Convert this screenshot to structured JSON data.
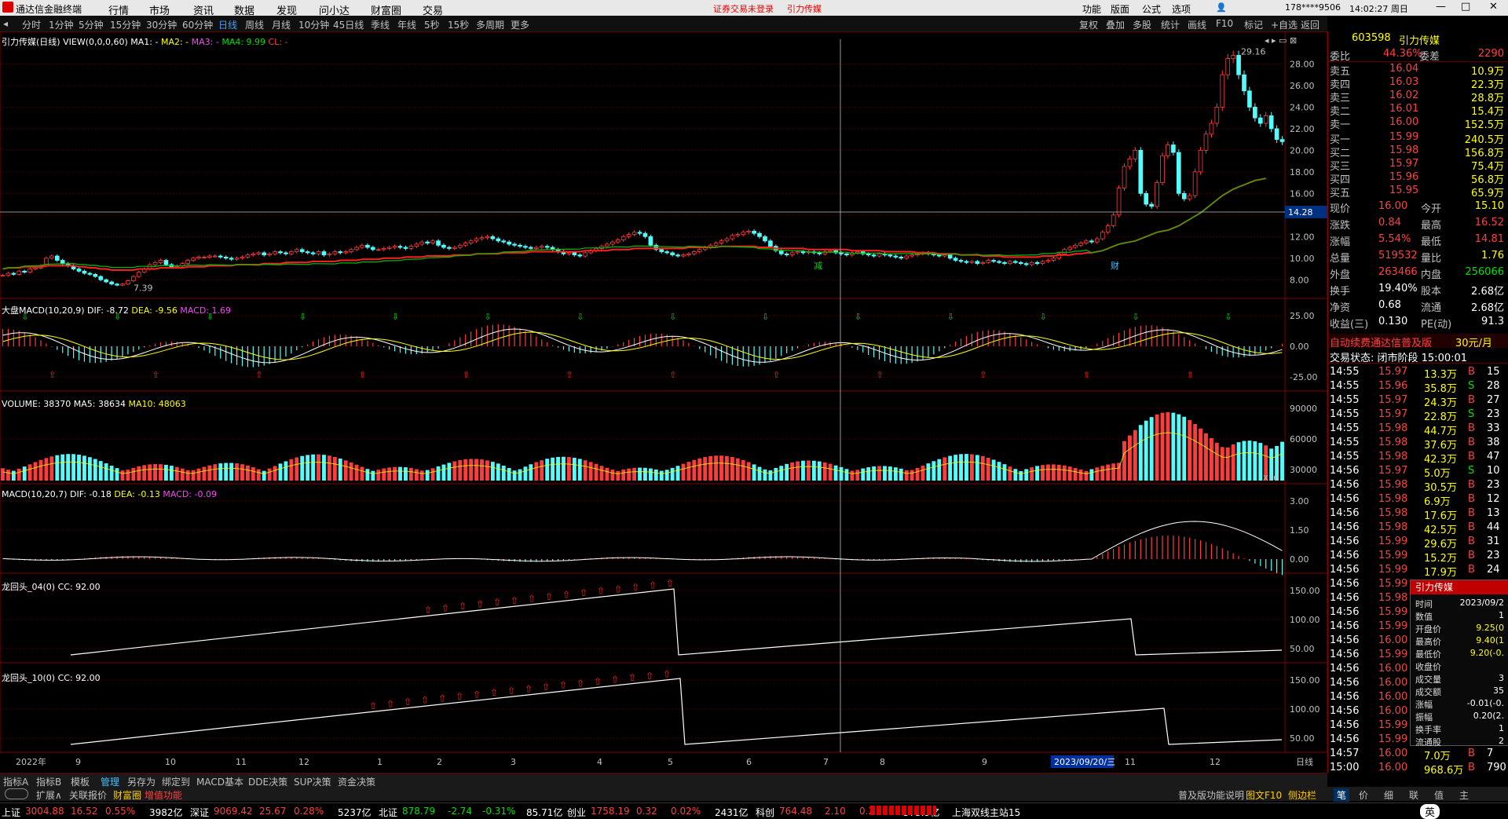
{
  "app": {
    "title": "通达信金融终端",
    "menu": [
      "行情",
      "市场",
      "资讯",
      "数据",
      "发现",
      "问小达",
      "财富圈",
      "交易"
    ],
    "notice": "证券交易未登录",
    "stock_name": "引力传媒",
    "right_menu": [
      "功能",
      "版面",
      "公式",
      "选项"
    ],
    "account": "178****9506",
    "clock": "14:02:27 周日"
  },
  "periods": [
    "分时",
    "1分钟",
    "5分钟",
    "15分钟",
    "30分钟",
    "60分钟",
    "日线",
    "周线",
    "月线",
    "10分钟",
    "45日线",
    "季线",
    "年线",
    "5秒",
    "15秒",
    "多周期",
    "更多"
  ],
  "toolbar_right": [
    "复权",
    "叠加",
    "多股",
    "统计",
    "画线",
    "F10",
    "标记",
    "+自选",
    "返回"
  ],
  "chart_data": [
    {
      "type": "line",
      "name": "main",
      "header": {
        "title": "引力传媒(日线)",
        "view": "VIEW(0,0,0,60)",
        "ma1": "MA1: -",
        "ma2": "MA2: -",
        "ma3": "MA3: -",
        "ma4": "MA4: 9.99",
        "ma5": "CL: -"
      },
      "ylim": [
        7,
        30
      ],
      "ticks": [
        8,
        10,
        12,
        14,
        16,
        18,
        20,
        22,
        24,
        26,
        28
      ],
      "tick_labels": [
        "8.00",
        "10.00",
        "12.00",
        "14.00",
        "16.00",
        "18.00",
        "20.00",
        "22.00",
        "24.00",
        "26.00",
        "28.00"
      ],
      "annotations": {
        "high": "29.16",
        "low": "7.39",
        "crosshair_price": "14.28",
        "marker1": "减",
        "marker2": "财"
      },
      "close": [
        8.4,
        8.6,
        8.5,
        8.8,
        8.7,
        9.0,
        9.1,
        9.3,
        10.0,
        10.2,
        9.8,
        9.5,
        9.3,
        9.0,
        8.8,
        8.6,
        8.5,
        8.3,
        8.0,
        7.8,
        7.6,
        7.5,
        7.6,
        7.9,
        8.3,
        8.7,
        9.0,
        9.4,
        9.6,
        9.8,
        9.4,
        9.2,
        9.3,
        9.5,
        9.8,
        10.0,
        10.1,
        10.1,
        10.2,
        10.2,
        10.1,
        10.0,
        9.9,
        10.0,
        10.1,
        10.3,
        10.4,
        10.5,
        10.3,
        10.4,
        10.6,
        10.5,
        10.4,
        10.6,
        10.8,
        10.6,
        10.5,
        10.4,
        10.6,
        10.3,
        10.4,
        10.6,
        10.5,
        10.6,
        10.8,
        11.0,
        11.2,
        11.0,
        10.8,
        10.8,
        10.9,
        11.0,
        11.1,
        11.0,
        10.9,
        11.1,
        11.3,
        11.5,
        11.4,
        11.6,
        11.2,
        11.0,
        10.9,
        11.0,
        11.2,
        11.4,
        11.6,
        11.8,
        11.9,
        12.0,
        11.8,
        11.6,
        11.5,
        11.3,
        11.2,
        11.1,
        11.0,
        10.9,
        11.0,
        11.1,
        11.0,
        10.8,
        10.6,
        10.4,
        10.5,
        10.3,
        10.2,
        10.5,
        10.7,
        10.9,
        11.1,
        11.3,
        11.5,
        11.7,
        12.0,
        12.2,
        12.4,
        12.3,
        12.0,
        11.2,
        10.8,
        10.6,
        10.5,
        10.3,
        10.2,
        10.3,
        10.4,
        10.6,
        10.8,
        11.0,
        11.2,
        11.4,
        11.6,
        11.8,
        12.1,
        12.2,
        12.4,
        12.5,
        12.3,
        12.0,
        11.6,
        11.1,
        10.7,
        10.4,
        10.3,
        10.5,
        10.6,
        10.5,
        10.6,
        10.5,
        10.4,
        10.6,
        10.7,
        10.5,
        10.4,
        10.3,
        10.5,
        10.6,
        10.4,
        10.3,
        10.2,
        10.4,
        10.3,
        10.2,
        10.1,
        10.0,
        10.2,
        10.3,
        10.4,
        10.5,
        10.4,
        10.3,
        10.2,
        10.3,
        10.0,
        9.8,
        9.7,
        9.6,
        9.7,
        9.5,
        9.6,
        9.8,
        9.7,
        9.6,
        9.5,
        9.7,
        9.6,
        9.5,
        9.4,
        9.6,
        9.5,
        9.7,
        9.8,
        10.0,
        10.4,
        10.8,
        11.0,
        11.2,
        11.4,
        11.6,
        11.5,
        11.8,
        12.4,
        13.0,
        14.0,
        16.5,
        18.5,
        19.2,
        20.0,
        16.0,
        15.0,
        14.8,
        17.0,
        19.5,
        20.5,
        19.8,
        16.0,
        15.5,
        15.8,
        18.0,
        20.0,
        21.5,
        22.5,
        24.0,
        27.0,
        28.5,
        28.8,
        27.0,
        25.5,
        24.0,
        23.0,
        22.5,
        23.2,
        22.0,
        21.0,
        20.8
      ],
      "ma": [
        9.0,
        9.1,
        9.1,
        9.1,
        9.2,
        9.2,
        9.2,
        9.2,
        9.3,
        9.3,
        9.3,
        9.3,
        9.3,
        9.3,
        9.2,
        9.2,
        9.1,
        9.1,
        9.0,
        9.0,
        8.9,
        8.9,
        8.9,
        8.9,
        8.9,
        9.0,
        9.0,
        9.0,
        9.0,
        9.1,
        9.1,
        9.1,
        9.1,
        9.1,
        9.2,
        9.2,
        9.2,
        9.2,
        9.3,
        9.3,
        9.3,
        9.3,
        9.3,
        9.4,
        9.4,
        9.4,
        9.4,
        9.4,
        9.5,
        9.5,
        9.5,
        9.5,
        9.6,
        9.6,
        9.6,
        9.6,
        9.6,
        9.7,
        9.7,
        9.7,
        9.7,
        9.7,
        9.8,
        9.8,
        9.8,
        9.8,
        9.9,
        9.9,
        9.9,
        9.9,
        10.0,
        10.0,
        10.0,
        10.0,
        10.1,
        10.1,
        10.1,
        10.1,
        10.2,
        10.2,
        10.2,
        10.2,
        10.2,
        10.3,
        10.3,
        10.3,
        10.3,
        10.4,
        10.4,
        10.4,
        10.4,
        10.4,
        10.5,
        10.5,
        10.5,
        10.5,
        10.5,
        10.6,
        10.6,
        10.6,
        10.6,
        10.6,
        10.6,
        10.6,
        10.6,
        10.6,
        10.6,
        10.7,
        10.7,
        10.7,
        10.7,
        10.7,
        10.8,
        10.8,
        10.8,
        10.8,
        10.9,
        10.9,
        10.9,
        10.9,
        10.9,
        10.9,
        10.9,
        10.9,
        10.9,
        10.9,
        11.0,
        11.0,
        11.0,
        11.0,
        11.0,
        11.0,
        11.1,
        11.1,
        11.1,
        11.1,
        11.1,
        11.1,
        11.1,
        11.0,
        11.0,
        11.0,
        10.9,
        10.9,
        10.9,
        10.9,
        10.9,
        10.9,
        10.8,
        10.8,
        10.8,
        10.8,
        10.8,
        10.8,
        10.8,
        10.8,
        10.7,
        10.7,
        10.7,
        10.7,
        10.7,
        10.7,
        10.6,
        10.6,
        10.6,
        10.6,
        10.6,
        10.6,
        10.5,
        10.5,
        10.5,
        10.5,
        10.4,
        10.4,
        10.4,
        10.4,
        10.3,
        10.3,
        10.3,
        10.3,
        10.2,
        10.2,
        10.2,
        10.2,
        10.1,
        10.1,
        10.1,
        10.1,
        10.1,
        10.1,
        10.1,
        10.2,
        10.2,
        10.2,
        10.3,
        10.3,
        10.3,
        10.4,
        10.4,
        10.5,
        10.5,
        10.6,
        10.7,
        10.9,
        11.1,
        11.3,
        11.4,
        11.5,
        11.6,
        11.8,
        12.0,
        12.2,
        12.4,
        12.5,
        12.6,
        12.8,
        13.0,
        13.3,
        13.6,
        13.9,
        14.2,
        14.6,
        15.0,
        15.4,
        15.8,
        16.1,
        16.4,
        16.6,
        16.8,
        17.0,
        17.2,
        17.3,
        17.4
      ]
    },
    {
      "type": "bar",
      "name": "大盘MACD",
      "header": {
        "title": "大盘MACD(10,20,9)",
        "dif": "DIF: -8.72",
        "dea": "DEA: -9.56",
        "macd": "MACD: 1.69"
      },
      "ticks": [
        "25.00",
        "0.00",
        "-25.00"
      ]
    },
    {
      "type": "bar",
      "name": "VOLUME",
      "header": {
        "title": "VOLUME: 38370",
        "ma5": "MA5: 38634",
        "ma10": "MA10: 48063"
      },
      "ticks": [
        "90000",
        "60000",
        "30000"
      ],
      "unit": "X10"
    },
    {
      "type": "bar",
      "name": "MACD",
      "header": {
        "title": "MACD(10,20,7)",
        "dif": "DIF: -0.18",
        "dea": "DEA: -0.13",
        "macd": "MACD: -0.09"
      },
      "ticks": [
        "3.00",
        "1.50",
        "0.00"
      ]
    },
    {
      "type": "line",
      "name": "龙回头_04",
      "header": {
        "title": "龙回头_04(0)",
        "cc": "CC: 92.00"
      },
      "ticks": [
        "150.00",
        "100.00",
        "50.00"
      ]
    },
    {
      "type": "line",
      "name": "龙回头_10",
      "header": {
        "title": "龙回头_10(0)",
        "cc": "CC: 92.00"
      },
      "ticks": [
        "150.00",
        "100.00",
        "50.00"
      ]
    }
  ],
  "xaxis": {
    "labels": [
      "2022年",
      "9",
      "10",
      "11",
      "12",
      "1",
      "2",
      "3",
      "4",
      "5",
      "6",
      "7",
      "8",
      "9",
      "2023/09/20/三",
      "11",
      "12",
      "日线"
    ]
  },
  "quote": {
    "code": "603598",
    "name": "引力传媒",
    "weibi_label": "委比",
    "weibi": "44.36%",
    "weicha_label": "委差",
    "weicha": "2290",
    "asks": [
      {
        "label": "卖五",
        "price": "16.04",
        "vol": "10.9万"
      },
      {
        "label": "卖四",
        "price": "16.03",
        "vol": "22.3万"
      },
      {
        "label": "卖三",
        "price": "16.02",
        "vol": "28.8万"
      },
      {
        "label": "卖二",
        "price": "16.01",
        "vol": "15.4万"
      },
      {
        "label": "卖一",
        "price": "16.00",
        "vol": "152.5万"
      }
    ],
    "bids": [
      {
        "label": "买一",
        "price": "15.99",
        "vol": "240.5万"
      },
      {
        "label": "买二",
        "price": "15.98",
        "vol": "156.8万"
      },
      {
        "label": "买三",
        "price": "15.97",
        "vol": "75.4万"
      },
      {
        "label": "买四",
        "price": "15.96",
        "vol": "56.8万"
      },
      {
        "label": "买五",
        "price": "15.95",
        "vol": "65.9万"
      }
    ],
    "stats": [
      {
        "l1": "现价",
        "v1": "16.00",
        "l2": "今开",
        "v2": "15.10"
      },
      {
        "l1": "涨跌",
        "v1": "0.84",
        "l2": "最高",
        "v2": "16.52"
      },
      {
        "l1": "涨幅",
        "v1": "5.54%",
        "l2": "最低",
        "v2": "14.81"
      },
      {
        "l1": "总量",
        "v1": "519532",
        "l2": "量比",
        "v2": "1.76"
      },
      {
        "l1": "外盘",
        "v1": "263466",
        "l2": "内盘",
        "v2": "256066"
      },
      {
        "l1": "换手",
        "v1": "19.40%",
        "l2": "股本",
        "v2": "2.68亿"
      },
      {
        "l1": "净资",
        "v1": "0.68",
        "l2": "流通",
        "v2": "2.68亿"
      },
      {
        "l1": "收益(三)",
        "v1": "0.130",
        "l2": "PE(动)",
        "v2": "91.3"
      }
    ],
    "promo": "自动续费通达信普及版",
    "promo_price": "30元/月",
    "trade_state": "交易状态: 闭市阶段 15:00:01",
    "ticks": [
      {
        "t": "14:55",
        "p": "15.97",
        "v": "13.3万",
        "d": "B",
        "n": "15"
      },
      {
        "t": "14:55",
        "p": "15.96",
        "v": "35.8万",
        "d": "S",
        "n": "28"
      },
      {
        "t": "14:55",
        "p": "15.97",
        "v": "24.3万",
        "d": "B",
        "n": "27"
      },
      {
        "t": "14:55",
        "p": "15.97",
        "v": "22.8万",
        "d": "S",
        "n": "23"
      },
      {
        "t": "14:55",
        "p": "15.98",
        "v": "44.7万",
        "d": "B",
        "n": "33"
      },
      {
        "t": "14:55",
        "p": "15.98",
        "v": "37.6万",
        "d": "B",
        "n": "38"
      },
      {
        "t": "14:55",
        "p": "15.98",
        "v": "42.3万",
        "d": "B",
        "n": "47"
      },
      {
        "t": "14:56",
        "p": "15.97",
        "v": "5.0万",
        "d": "S",
        "n": "10"
      },
      {
        "t": "14:56",
        "p": "15.98",
        "v": "30.5万",
        "d": "B",
        "n": "23"
      },
      {
        "t": "14:56",
        "p": "15.98",
        "v": "6.9万",
        "d": "B",
        "n": "12"
      },
      {
        "t": "14:56",
        "p": "15.98",
        "v": "17.6万",
        "d": "B",
        "n": "13"
      },
      {
        "t": "14:56",
        "p": "15.98",
        "v": "42.5万",
        "d": "B",
        "n": "44"
      },
      {
        "t": "14:56",
        "p": "15.99",
        "v": "29.6万",
        "d": "B",
        "n": "31"
      },
      {
        "t": "14:56",
        "p": "15.99",
        "v": "15.2万",
        "d": "B",
        "n": "23"
      },
      {
        "t": "14:56",
        "p": "15.99",
        "v": "17.9万",
        "d": "B",
        "n": "24"
      },
      {
        "t": "14:56",
        "p": "15.99",
        "v": "",
        "d": "",
        "n": ""
      },
      {
        "t": "14:56",
        "p": "15.98",
        "v": "",
        "d": "",
        "n": ""
      },
      {
        "t": "14:56",
        "p": "15.99",
        "v": "",
        "d": "",
        "n": ""
      },
      {
        "t": "14:56",
        "p": "15.99",
        "v": "",
        "d": "",
        "n": ""
      },
      {
        "t": "14:56",
        "p": "16.00",
        "v": "",
        "d": "",
        "n": ""
      },
      {
        "t": "14:56",
        "p": "15.99",
        "v": "",
        "d": "",
        "n": ""
      },
      {
        "t": "14:56",
        "p": "16.00",
        "v": "",
        "d": "",
        "n": ""
      },
      {
        "t": "14:56",
        "p": "16.00",
        "v": "",
        "d": "",
        "n": ""
      },
      {
        "t": "14:56",
        "p": "16.00",
        "v": "",
        "d": "",
        "n": ""
      },
      {
        "t": "14:56",
        "p": "16.00",
        "v": "",
        "d": "",
        "n": ""
      },
      {
        "t": "14:56",
        "p": "15.99",
        "v": "",
        "d": "",
        "n": ""
      },
      {
        "t": "14:56",
        "p": "15.99",
        "v": "",
        "d": "",
        "n": ""
      },
      {
        "t": "14:57",
        "p": "16.00",
        "v": "7.0万",
        "d": "B",
        "n": "7"
      },
      {
        "t": "15:00",
        "p": "16.00",
        "v": "968.6万",
        "d": "B",
        "n": "790"
      }
    ]
  },
  "popup": {
    "title": "引力传媒",
    "rows": [
      {
        "k": "时间",
        "v": "2023/09/2"
      },
      {
        "k": "数值",
        "v": "1"
      },
      {
        "k": "开盘价",
        "v": "9.25(0"
      },
      {
        "k": "最高价",
        "v": "9.40(1"
      },
      {
        "k": "最低价",
        "v": "9.20(-0."
      },
      {
        "k": "收盘价",
        "v": ""
      },
      {
        "k": "成交量",
        "v": "3"
      },
      {
        "k": "成交额",
        "v": "35"
      },
      {
        "k": "涨幅",
        "v": "-0.01(-0."
      },
      {
        "k": "振幅",
        "v": "0.20(2."
      },
      {
        "k": "换手率",
        "v": "1"
      },
      {
        "k": "流通股",
        "v": "2"
      }
    ]
  },
  "bottom_tabs": [
    "指标A",
    "指标B",
    "模板",
    "管理",
    "另存为",
    "绑定到",
    "MACD基本",
    "DDE决策",
    "SUP决策",
    "资金决策"
  ],
  "bottom_tabs2": [
    "扩展∧",
    "关联报价",
    "财富圈",
    "增值功能"
  ],
  "bottom_right": [
    "普及版功能说明",
    "图文F10",
    "侧边栏"
  ],
  "right_tabs": [
    "笔",
    "价",
    "细",
    "联",
    "值",
    "主"
  ],
  "indices": [
    {
      "name": "上证",
      "val": "3004.88",
      "chg": "16.52",
      "pct": "0.55%",
      "amt": "3982亿"
    },
    {
      "name": "深证",
      "val": "9069.42",
      "chg": "25.67",
      "pct": "0.28%",
      "amt": "5237亿"
    },
    {
      "name": "北证",
      "val": "878.79",
      "chg": "-2.74",
      "pct": "-0.31%",
      "amt": "85.71亿"
    },
    {
      "name": "创业",
      "val": "1758.19",
      "chg": "0.32",
      "pct": "0.02%",
      "amt": "2431亿"
    },
    {
      "name": "科创",
      "val": "764.48",
      "chg": "2.10",
      "pct": "0.28%",
      "amt": "573.9亿"
    }
  ],
  "server": "上海双线主站15",
  "ime": "英"
}
